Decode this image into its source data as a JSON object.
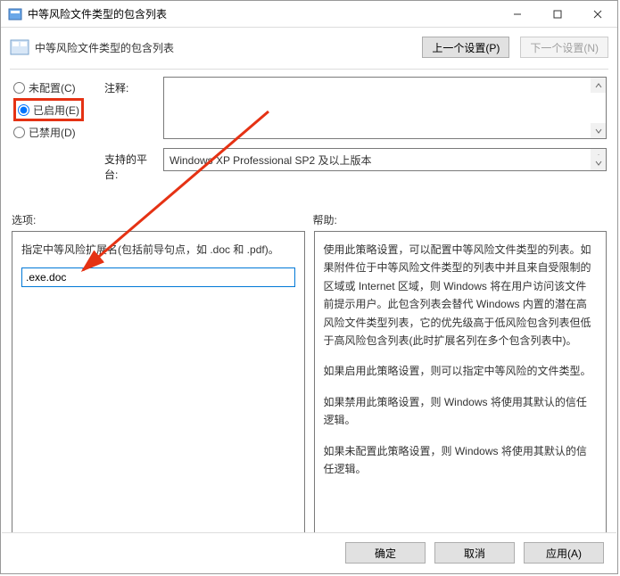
{
  "titlebar": {
    "text": "中等风险文件类型的包含列表"
  },
  "header": {
    "text": "中等风险文件类型的包含列表",
    "prev_btn": "上一个设置(P)",
    "next_btn": "下一个设置(N)"
  },
  "radios": {
    "not_configured": "未配置(C)",
    "enabled": "已启用(E)",
    "disabled": "已禁用(D)",
    "selected": "enabled"
  },
  "labels": {
    "comment": "注释:",
    "platform": "支持的平台:",
    "options": "选项:",
    "help": "帮助:"
  },
  "platform_text": "Windows XP Professional SP2 及以上版本",
  "options_panel": {
    "instruction": "指定中等风险扩展名(包括前导句点，如 .doc 和 .pdf)。",
    "input_value": ".exe.doc"
  },
  "help_panel": {
    "p1": "使用此策略设置，可以配置中等风险文件类型的列表。如果附件位于中等风险文件类型的列表中并且来自受限制的区域或 Internet 区域，则 Windows 将在用户访问该文件前提示用户。此包含列表会替代 Windows 内置的潜在高风险文件类型列表，它的优先级高于低风险包含列表但低于高风险包含列表(此时扩展名列在多个包含列表中)。",
    "p2": "如果启用此策略设置，则可以指定中等风险的文件类型。",
    "p3": "如果禁用此策略设置，则 Windows 将使用其默认的信任逻辑。",
    "p4": "如果未配置此策略设置，则 Windows 将使用其默认的信任逻辑。"
  },
  "footer": {
    "ok": "确定",
    "cancel": "取消",
    "apply": "应用(A)"
  }
}
